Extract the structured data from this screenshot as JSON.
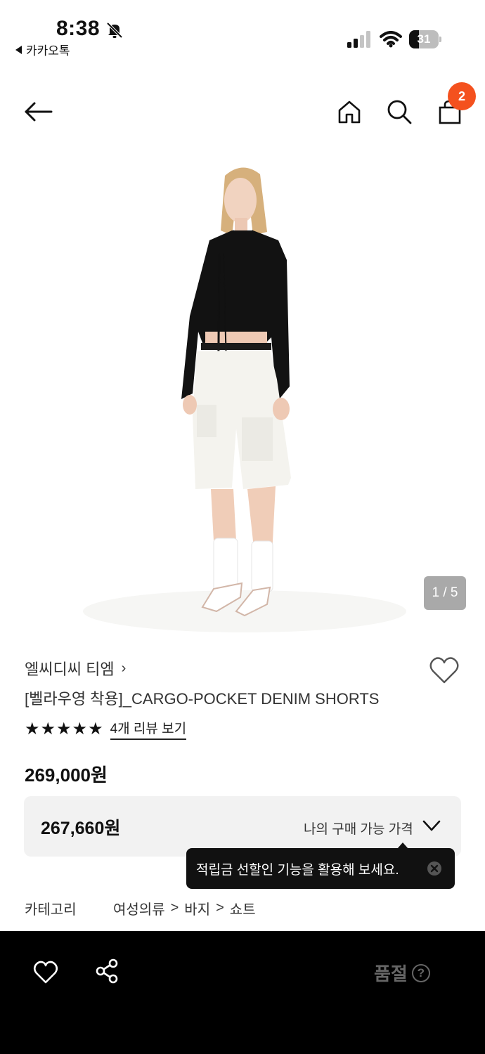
{
  "status_bar": {
    "time": "8:38",
    "back_app_label": "카카오톡",
    "battery_level": "31"
  },
  "header": {
    "cart_badge_count": "2"
  },
  "gallery": {
    "page_indicator": "1 / 5",
    "background_color": "#ffffff"
  },
  "product": {
    "brand": "엘씨디씨 티엠",
    "brand_chevron": "›",
    "name": "[벨라우영 착용]_CARGO-POCKET DENIM SHORTS",
    "rating_stars": 5,
    "review_link": "4개 리뷰 보기",
    "price": "269,000원",
    "my_price": "267,660원",
    "my_price_label": "나의 구매 가능 가격"
  },
  "tooltip": {
    "text": "적립금 선할인 기능을 활용해 보세요."
  },
  "category": {
    "label": "카테고리",
    "crumbs": [
      "여성의류",
      "바지",
      "쇼트"
    ]
  },
  "bottom_bar": {
    "status": "품절",
    "help_symbol": "?"
  },
  "colors": {
    "badge": "#f4511e",
    "bottom_bar": "#000000",
    "soldout_text": "#666666"
  }
}
